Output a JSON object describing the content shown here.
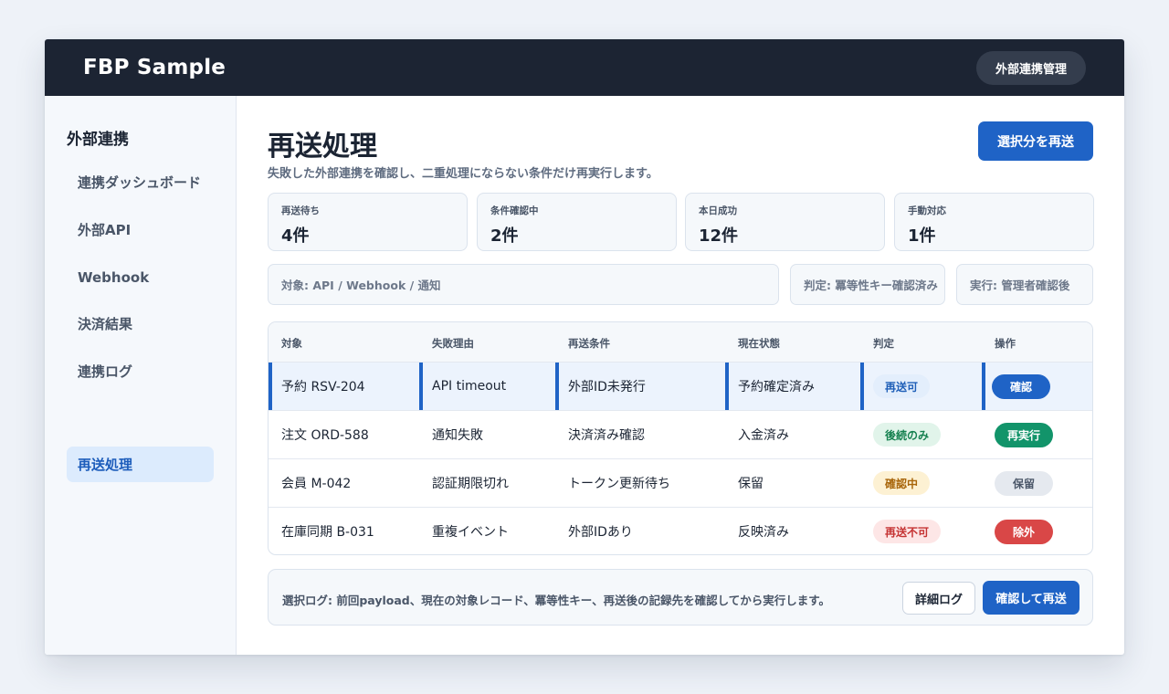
{
  "app": {
    "title": "FBP Sample",
    "top_button": "外部連携管理"
  },
  "sidebar": {
    "title": "外部連携",
    "items": [
      {
        "label": "連携ダッシュボード",
        "active": false
      },
      {
        "label": "外部API",
        "active": false
      },
      {
        "label": "Webhook",
        "active": false
      },
      {
        "label": "決済結果",
        "active": false
      },
      {
        "label": "連携ログ",
        "active": false
      },
      {
        "label": "再送処理",
        "active": true
      }
    ]
  },
  "page": {
    "title": "再送処理",
    "subtitle": "失敗した外部連携を確認し、二重処理にならない条件だけ再実行します。",
    "primary_button": "選択分を再送"
  },
  "stats": [
    {
      "label": "再送待ち",
      "value": "4件"
    },
    {
      "label": "条件確認中",
      "value": "2件"
    },
    {
      "label": "本日成功",
      "value": "12件"
    },
    {
      "label": "手動対応",
      "value": "1件"
    }
  ],
  "filters": [
    {
      "label": "対象: API / Webhook / 通知"
    },
    {
      "label": "判定: 冪等性キー確認済み"
    },
    {
      "label": "実行: 管理者確認後"
    }
  ],
  "table": {
    "headers": [
      "対象",
      "失敗理由",
      "再送条件",
      "現在状態",
      "判定",
      "操作"
    ],
    "rows": [
      {
        "target": "予約 RSV-204",
        "reason": "API timeout",
        "condition": "外部ID未発行",
        "status": "予約確定済み",
        "verdict": "再送可",
        "action": "確認",
        "selected": true
      },
      {
        "target": "注文 ORD-588",
        "reason": "通知失敗",
        "condition": "決済済み確認",
        "status": "入金済み",
        "verdict": "後続のみ",
        "action": "再実行",
        "selected": false
      },
      {
        "target": "会員 M-042",
        "reason": "認証期限切れ",
        "condition": "トークン更新待ち",
        "status": "保留",
        "verdict": "確認中",
        "action": "保留",
        "selected": false
      },
      {
        "target": "在庫同期 B-031",
        "reason": "重複イベント",
        "condition": "外部IDあり",
        "status": "反映済み",
        "verdict": "再送不可",
        "action": "除外",
        "selected": false
      }
    ]
  },
  "footer": {
    "text": "選択ログ: 前回payload、現在の対象レコード、冪等性キー、再送後の記録先を確認してから実行します。",
    "detail_button": "詳細ログ",
    "confirm_button": "確認して再送"
  },
  "colors": {
    "header_bg": "#1c2433",
    "primary": "#1f63c6",
    "active_nav_bg": "#dcebfd",
    "badge_blue": "#e3eefc",
    "badge_green": "#e1f4ea",
    "badge_yellow": "#fdf1d3",
    "badge_red": "#fde6e6",
    "btn_green": "#12946a",
    "btn_red": "#d94747",
    "btn_gray": "#e5e9ef"
  }
}
